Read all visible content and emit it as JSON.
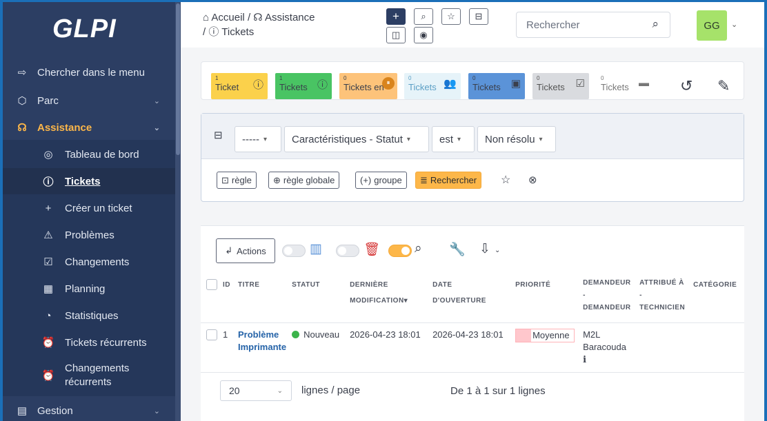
{
  "app": {
    "logo": "GLPI"
  },
  "sidebar": {
    "items": [
      {
        "icon": "⇨",
        "label": "Chercher dans le menu"
      },
      {
        "icon": "⬡",
        "label": "Parc"
      },
      {
        "icon": "☊",
        "label": "Assistance"
      }
    ],
    "sub_items": [
      {
        "icon": "◎",
        "label": "Tableau de bord"
      },
      {
        "icon": "ⓘ",
        "label": "Tickets"
      },
      {
        "icon": "+",
        "label": "Créer un ticket"
      },
      {
        "icon": "⚠",
        "label": "Problèmes"
      },
      {
        "icon": "☑",
        "label": "Changements"
      },
      {
        "icon": "▦",
        "label": "Planning"
      },
      {
        "icon": "◔",
        "label": "Statistiques"
      },
      {
        "icon": "⏰",
        "label": "Tickets récurrents"
      },
      {
        "icon": "⏰",
        "label_line1": "Changements",
        "label_line2": "récurrents"
      }
    ],
    "bottom": {
      "icon": "▤",
      "label": "Gestion"
    }
  },
  "header": {
    "breadcrumb": {
      "home_icon": "⌂",
      "home": "Accueil",
      "sep": "/",
      "section_icon": "☊",
      "section": "Assistance",
      "page_icon": "ⓘ",
      "page": "Tickets"
    },
    "search_placeholder": "Rechercher",
    "avatar": "GG"
  },
  "status_cards": [
    {
      "count": "1",
      "label": "Ticket",
      "icon": "ⓘ",
      "color": "#fbd14b"
    },
    {
      "count": "1",
      "label": "Tickets",
      "icon": "ⓘ",
      "color": "#49c463"
    },
    {
      "count": "0",
      "label": "Tickets en",
      "icon": "⏸",
      "color": "#fdc37a"
    },
    {
      "count": "0",
      "label": "Tickets",
      "icon": "👥",
      "color": "#e6f3f9"
    },
    {
      "count": "0",
      "label": "Tickets",
      "icon": "▣",
      "color": "#5b93d8"
    },
    {
      "count": "0",
      "label": "Tickets",
      "icon": "☑",
      "color": "#d9dbdf"
    },
    {
      "count": "0",
      "label": "Tickets",
      "icon": "▬",
      "color": "#ffffff"
    }
  ],
  "criteria": {
    "collapse_icon": "⊟",
    "field_link": "-----",
    "field": "Caractéristiques - Statut",
    "operator": "est",
    "value": "Non résolu",
    "buttons": {
      "rule": "règle",
      "global_rule": "règle globale",
      "group": "groupe",
      "search": "Rechercher"
    }
  },
  "results": {
    "actions_label": "Actions",
    "columns": {
      "id": "ID",
      "title": "TITRE",
      "status": "STATUT",
      "last_mod_1": "DERNIÈRE",
      "last_mod_2": "MODIFICATION",
      "open_1": "DATE",
      "open_2": "D'OUVERTURE",
      "priority": "PRIORITÉ",
      "req_1": "DEMANDEUR",
      "req_2": "-",
      "req_3": "DEMANDEUR",
      "tech_1": "ATTRIBUÉ À",
      "tech_2": "-",
      "tech_3": "TECHNICIEN",
      "category": "CATÉGORIE"
    },
    "rows": [
      {
        "id": "1",
        "title_1": "Problème",
        "title_2": "Imprimante",
        "status": "Nouveau",
        "last_mod": "2026-04-23 18:01",
        "opened": "2026-04-23 18:01",
        "priority": "Moyenne",
        "requester_1": "M2L",
        "requester_2": "Baracouda",
        "info": "i"
      }
    ],
    "pager": {
      "per_page": "20",
      "per_page_label": "lignes / page",
      "summary": "De 1 à 1 sur 1 lignes"
    }
  },
  "colors": {
    "sidebar": "#2c3e63",
    "accent": "#fdb749",
    "link": "#2563a8"
  }
}
